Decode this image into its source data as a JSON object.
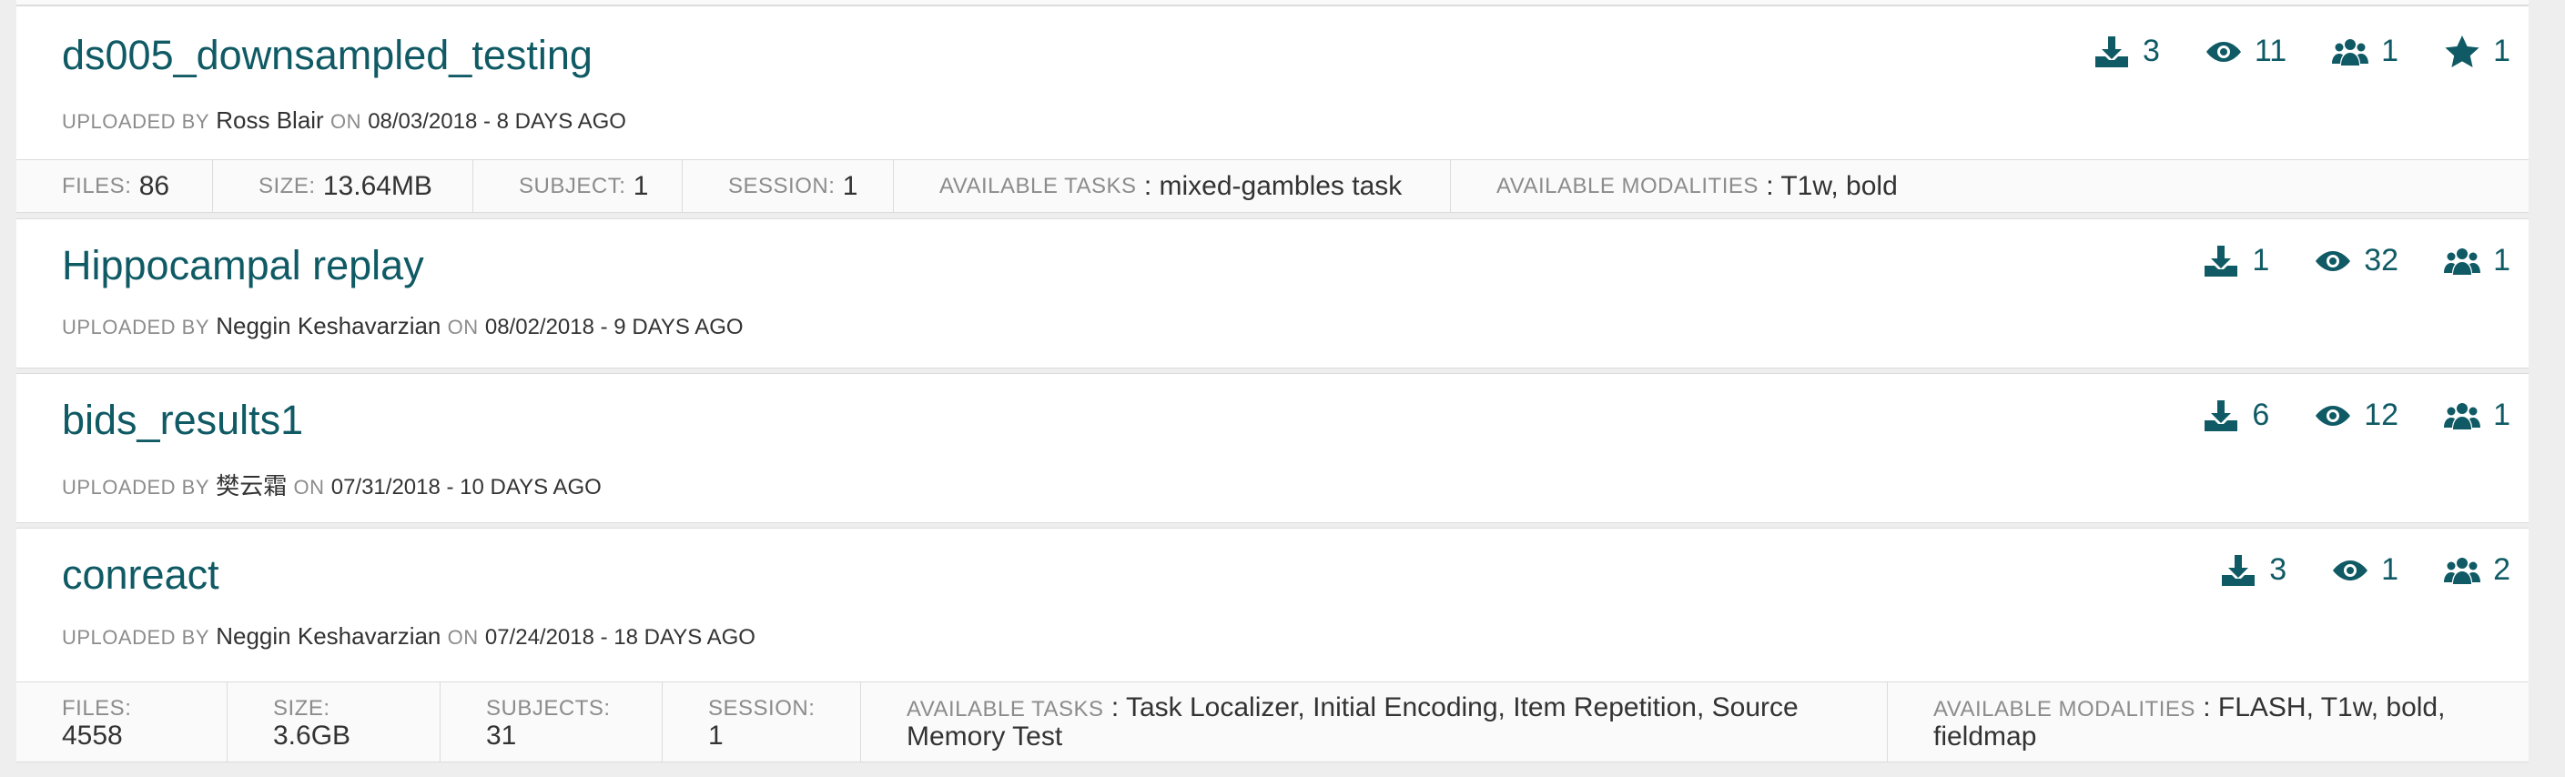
{
  "datasets": [
    {
      "name": "ds005_downsampled_testing",
      "uploaded_by_label": "UPLOADED BY",
      "uploader": "Ross Blair",
      "on_label": "ON",
      "date": "08/03/2018 - 8 DAYS AGO",
      "stats": {
        "downloads": "3",
        "views": "11",
        "followers": "1",
        "stars": "1"
      },
      "meta": {
        "files_label": "FILES:",
        "files": "86",
        "size_label": "SIZE:",
        "size": "13.64MB",
        "subject_label": "SUBJECT:",
        "subject": "1",
        "session_label": "SESSION:",
        "session": "1",
        "tasks_label": "AVAILABLE TASKS",
        "tasks": ": mixed-gambles task",
        "modalities_label": "AVAILABLE MODALITIES",
        "modalities": ": T1w, bold"
      }
    },
    {
      "name": "Hippocampal replay",
      "uploaded_by_label": "UPLOADED BY",
      "uploader": "Neggin Keshavarzian",
      "on_label": "ON",
      "date": "08/02/2018 - 9 DAYS AGO",
      "stats": {
        "downloads": "1",
        "views": "32",
        "followers": "1"
      }
    },
    {
      "name": "bids_results1",
      "uploaded_by_label": "UPLOADED BY",
      "uploader": "樊云霜",
      "on_label": "ON",
      "date": "07/31/2018 - 10 DAYS AGO",
      "stats": {
        "downloads": "6",
        "views": "12",
        "followers": "1"
      }
    },
    {
      "name": "conreact",
      "uploaded_by_label": "UPLOADED BY",
      "uploader": "Neggin Keshavarzian",
      "on_label": "ON",
      "date": "07/24/2018 - 18 DAYS AGO",
      "stats": {
        "downloads": "3",
        "views": "1",
        "followers": "2"
      },
      "meta": {
        "files_label": "FILES:",
        "files": "4558",
        "size_label": "SIZE:",
        "size": "3.6GB",
        "subjects_label": "SUBJECTS:",
        "subjects": "31",
        "session_label": "SESSION:",
        "session": "1",
        "tasks_label": "AVAILABLE TASKS",
        "tasks_line1": ": Task Localizer, Initial Encoding, Item Repetition, Source",
        "tasks_line2": "Memory Test",
        "modalities_label": "AVAILABLE MODALITIES",
        "modalities_line1": ": FLASH, T1w, bold,",
        "modalities_line2": "fieldmap"
      }
    }
  ],
  "icons": {
    "download": "download-icon",
    "views": "eye-icon",
    "followers": "users-icon",
    "stars": "star-icon"
  },
  "colors": {
    "accent": "#0f5a64",
    "muted": "#8c8c8c",
    "background": "#eeeeee"
  }
}
